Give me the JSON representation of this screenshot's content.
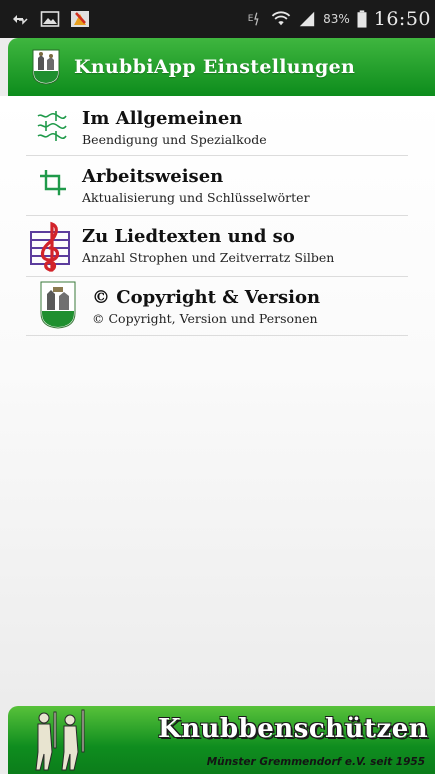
{
  "status_bar": {
    "icons_left": [
      "sync-icon",
      "image-icon",
      "app-notification-icon"
    ],
    "icons_right": [
      "data-transfer-icon",
      "wifi-icon",
      "signal-icon",
      "battery-icon"
    ],
    "battery": "83%",
    "time": "16:50"
  },
  "action_bar": {
    "title": "KnubbiApp Einstellungen",
    "icon": "club-logo-icon"
  },
  "menu": {
    "items": [
      {
        "title": "Im Allgemeinen",
        "subtitle": "Beendigung und Spezialkode",
        "icon": "sliders-icon"
      },
      {
        "title": "Arbeitsweisen",
        "subtitle": "Aktualisierung und Schlüsselwörter",
        "icon": "crop-icon"
      },
      {
        "title": "Zu Liedtexten und so",
        "subtitle": "Anzahl Strophen und Zeitverratz Silben",
        "icon": "music-staff-icon"
      },
      {
        "title": "© Copyright & Version",
        "subtitle": "© Copyright, Version und Personen",
        "icon": "club-shield-icon"
      }
    ]
  },
  "footer": {
    "title": "Knubbenschützen",
    "subtitle": "Münster Gremmendorf e.V. seit 1955"
  },
  "colors": {
    "accent_green": "#1a9e2a",
    "status_bar": "#1a1a1a",
    "icon_green": "#1f9a4a",
    "music_red": "#d2232a",
    "music_purple": "#5b3c9c"
  }
}
